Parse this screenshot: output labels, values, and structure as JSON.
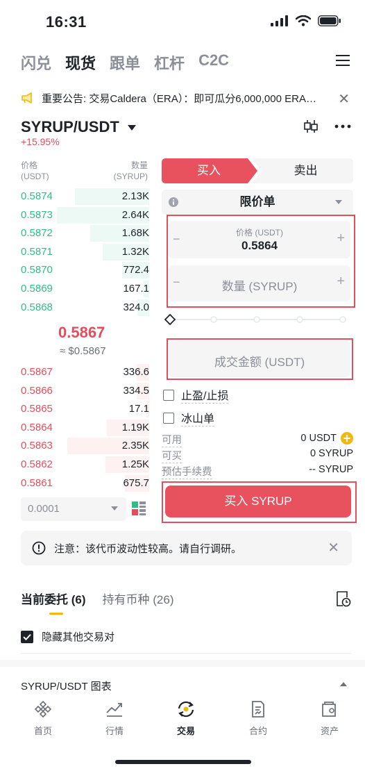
{
  "status": {
    "time": "16:31"
  },
  "top_tabs": [
    "闪兑",
    "现货",
    "跟单",
    "杠杆",
    "C2C"
  ],
  "announcement": {
    "text": "重要公告: 交易Caldera（ERA）：即可瓜分6,000,000 ERA…"
  },
  "pair": {
    "name": "SYRUP/USDT",
    "change": "+15.95%"
  },
  "orderbook": {
    "price_header": "价格",
    "price_unit": "(USDT)",
    "qty_header": "数量",
    "qty_unit": "(SYRUP)",
    "asks": [
      {
        "price": "0.5874",
        "qty": "2.13K",
        "depth": 0.58
      },
      {
        "price": "0.5873",
        "qty": "2.64K",
        "depth": 0.72
      },
      {
        "price": "0.5872",
        "qty": "1.68K",
        "depth": 0.46
      },
      {
        "price": "0.5871",
        "qty": "1.32K",
        "depth": 0.36
      },
      {
        "price": "0.5870",
        "qty": "772.4",
        "depth": 0.21
      },
      {
        "price": "0.5869",
        "qty": "167.1",
        "depth": 0.05
      },
      {
        "price": "0.5868",
        "qty": "324.0",
        "depth": 0.09
      }
    ],
    "last_price": "0.5867",
    "last_price_usd": "≈ $0.5867",
    "bids": [
      {
        "price": "0.5867",
        "qty": "336.6",
        "depth": 0.1
      },
      {
        "price": "0.5866",
        "qty": "334.5",
        "depth": 0.1
      },
      {
        "price": "0.5865",
        "qty": "17.1",
        "depth": 0.02
      },
      {
        "price": "0.5864",
        "qty": "1.19K",
        "depth": 0.33
      },
      {
        "price": "0.5863",
        "qty": "2.35K",
        "depth": 0.64
      },
      {
        "price": "0.5862",
        "qty": "1.25K",
        "depth": 0.34
      },
      {
        "price": "0.5861",
        "qty": "675.7",
        "depth": 0.19
      }
    ],
    "precision": "0.0001"
  },
  "trade": {
    "buy_tab": "买入",
    "sell_tab": "卖出",
    "order_type": "限价单",
    "price_label": "价格 (USDT)",
    "price_value": "0.5864",
    "qty_placeholder": "数量 (SYRUP)",
    "total_placeholder": "成交金额 (USDT)",
    "tp_sl": "止盈/止损",
    "iceberg": "冰山单",
    "available_label": "可用",
    "available_value": "0 USDT",
    "max_buy_label": "可买",
    "max_buy_value": "0 SYRUP",
    "fee_label": "预估手续费",
    "fee_value": "-- SYRUP",
    "buy_button": "买入 SYRUP"
  },
  "notice": {
    "text": "注意：该代币波动性较高。请自行调研。"
  },
  "orders": {
    "open_orders": "当前委托",
    "open_count": "(6)",
    "holdings": "持有币种",
    "holdings_count": "(26)",
    "hide_other": "隐藏其他交易对"
  },
  "chart_section": {
    "title": "SYRUP/USDT 图表"
  },
  "bottom_nav": [
    "首页",
    "行情",
    "交易",
    "合约",
    "资产"
  ],
  "colors": {
    "buy": "#e8515e",
    "ask_green": "#2ebd85",
    "bid_red": "#e24e5b",
    "accent_yellow": "#f0b90b"
  }
}
